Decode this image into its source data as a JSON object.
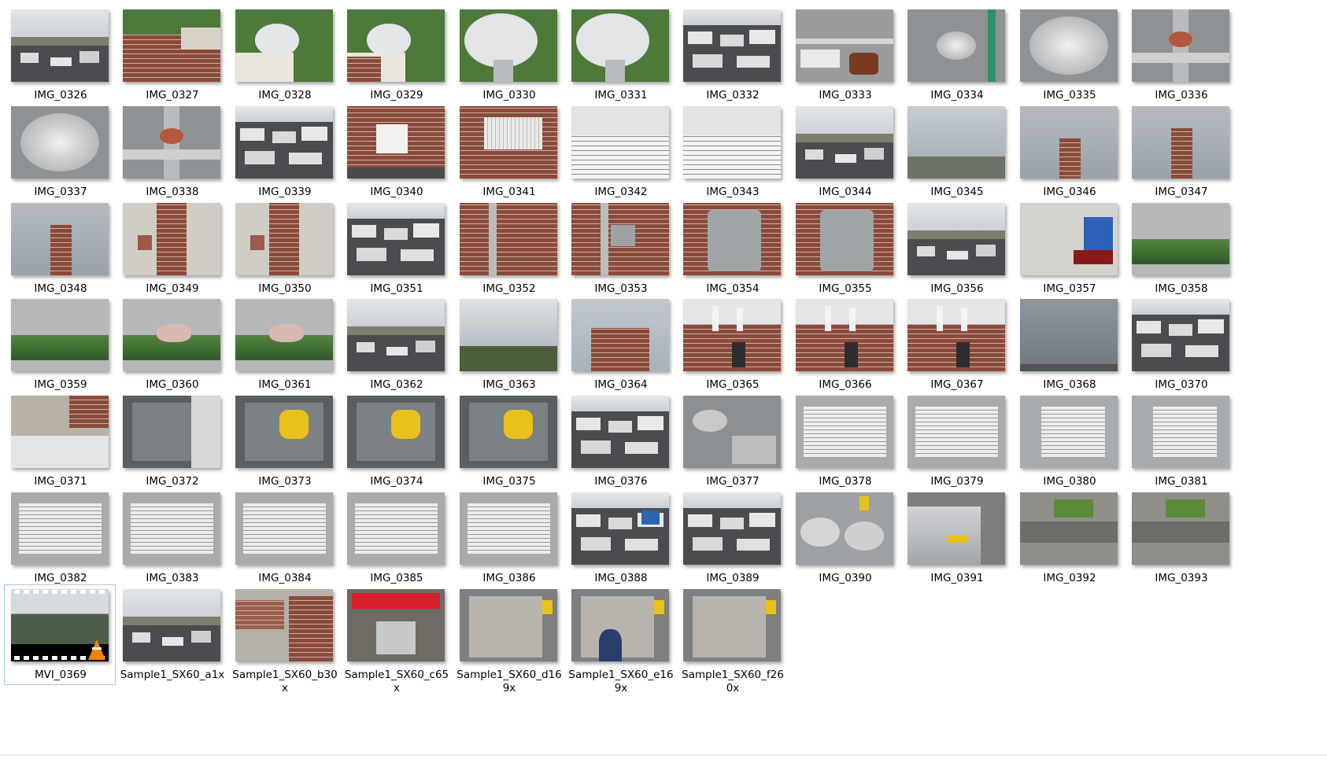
{
  "window": {
    "title": ""
  },
  "items": [
    {
      "name": "IMG_0326",
      "scene": "rooftop"
    },
    {
      "name": "IMG_0327",
      "scene": "brick-trees"
    },
    {
      "name": "IMG_0328",
      "scene": "dish-trees"
    },
    {
      "name": "IMG_0329",
      "scene": "dish-brick"
    },
    {
      "name": "IMG_0330",
      "scene": "dish-close"
    },
    {
      "name": "IMG_0331",
      "scene": "dish-close"
    },
    {
      "name": "IMG_0332",
      "scene": "rooftop-units"
    },
    {
      "name": "IMG_0333",
      "scene": "pipes"
    },
    {
      "name": "IMG_0334",
      "scene": "gauge"
    },
    {
      "name": "IMG_0335",
      "scene": "gauge-close"
    },
    {
      "name": "IMG_0336",
      "scene": "valve"
    },
    {
      "name": "IMG_0337",
      "scene": "gauge-close"
    },
    {
      "name": "IMG_0338",
      "scene": "valve"
    },
    {
      "name": "IMG_0339",
      "scene": "rooftop-units"
    },
    {
      "name": "IMG_0340",
      "scene": "brick-window"
    },
    {
      "name": "IMG_0341",
      "scene": "ac-brick"
    },
    {
      "name": "IMG_0342",
      "scene": "ac-grille"
    },
    {
      "name": "IMG_0343",
      "scene": "ac-grille"
    },
    {
      "name": "IMG_0344",
      "scene": "rooftop"
    },
    {
      "name": "IMG_0345",
      "scene": "skyline"
    },
    {
      "name": "IMG_0346",
      "scene": "chimney-far"
    },
    {
      "name": "IMG_0347",
      "scene": "chimney"
    },
    {
      "name": "IMG_0348",
      "scene": "chimney"
    },
    {
      "name": "IMG_0349",
      "scene": "facade"
    },
    {
      "name": "IMG_0350",
      "scene": "facade"
    },
    {
      "name": "IMG_0351",
      "scene": "rooftop-units"
    },
    {
      "name": "IMG_0352",
      "scene": "brick-pipe"
    },
    {
      "name": "IMG_0353",
      "scene": "brick-outlet"
    },
    {
      "name": "IMG_0354",
      "scene": "outlet-close"
    },
    {
      "name": "IMG_0355",
      "scene": "outlet-close"
    },
    {
      "name": "IMG_0356",
      "scene": "rooftop"
    },
    {
      "name": "IMG_0357",
      "scene": "street-blue"
    },
    {
      "name": "IMG_0358",
      "scene": "plants-concrete"
    },
    {
      "name": "IMG_0359",
      "scene": "plants-concrete"
    },
    {
      "name": "IMG_0360",
      "scene": "plants-rock"
    },
    {
      "name": "IMG_0361",
      "scene": "plants-rock"
    },
    {
      "name": "IMG_0362",
      "scene": "rooftop"
    },
    {
      "name": "IMG_0363",
      "scene": "trees-sky"
    },
    {
      "name": "IMG_0364",
      "scene": "building-sky"
    },
    {
      "name": "IMG_0365",
      "scene": "antenna-brick"
    },
    {
      "name": "IMG_0366",
      "scene": "antenna-brick"
    },
    {
      "name": "IMG_0367",
      "scene": "antenna-brick"
    },
    {
      "name": "IMG_0368",
      "scene": "sky"
    },
    {
      "name": "IMG_0370",
      "scene": "rooftop-units"
    },
    {
      "name": "IMG_0371",
      "scene": "street-building"
    },
    {
      "name": "IMG_0372",
      "scene": "equipment"
    },
    {
      "name": "IMG_0373",
      "scene": "equipment-yellow"
    },
    {
      "name": "IMG_0374",
      "scene": "equipment-yellow"
    },
    {
      "name": "IMG_0375",
      "scene": "equipment-yellow"
    },
    {
      "name": "IMG_0376",
      "scene": "rooftop-units"
    },
    {
      "name": "IMG_0377",
      "scene": "fans"
    },
    {
      "name": "IMG_0378",
      "scene": "label-panel"
    },
    {
      "name": "IMG_0379",
      "scene": "label-panel"
    },
    {
      "name": "IMG_0380",
      "scene": "label-sticker"
    },
    {
      "name": "IMG_0381",
      "scene": "label-sticker"
    },
    {
      "name": "IMG_0382",
      "scene": "label-panel"
    },
    {
      "name": "IMG_0383",
      "scene": "label-panel"
    },
    {
      "name": "IMG_0384",
      "scene": "label-panel"
    },
    {
      "name": "IMG_0385",
      "scene": "label-panel"
    },
    {
      "name": "IMG_0386",
      "scene": "label-panel"
    },
    {
      "name": "IMG_0388",
      "scene": "rooftop-blue"
    },
    {
      "name": "IMG_0389",
      "scene": "rooftop-units"
    },
    {
      "name": "IMG_0390",
      "scene": "fans-street"
    },
    {
      "name": "IMG_0391",
      "scene": "car"
    },
    {
      "name": "IMG_0392",
      "scene": "curb"
    },
    {
      "name": "IMG_0393",
      "scene": "curb"
    },
    {
      "name": "MVI_0369",
      "scene": "video",
      "selected": true
    },
    {
      "name": "Sample1_SX60_a1x",
      "scene": "rooftop"
    },
    {
      "name": "Sample1_SX60_b30x",
      "scene": "brick-street"
    },
    {
      "name": "Sample1_SX60_c65x",
      "scene": "grocery"
    },
    {
      "name": "Sample1_SX60_d169x",
      "scene": "storefront"
    },
    {
      "name": "Sample1_SX60_e169x",
      "scene": "storefront-person"
    },
    {
      "name": "Sample1_SX60_f260x",
      "scene": "storefront"
    }
  ],
  "colors": {
    "selection_border": "#99c9ef",
    "sky": "#c9cfd6",
    "roof": "#4a4c50",
    "brick": "#8b4a3a",
    "foliage": "#4d7a3a",
    "metal": "#b9bcbf",
    "yellow": "#e8c21a",
    "accent_orange": "#ff7f00"
  }
}
